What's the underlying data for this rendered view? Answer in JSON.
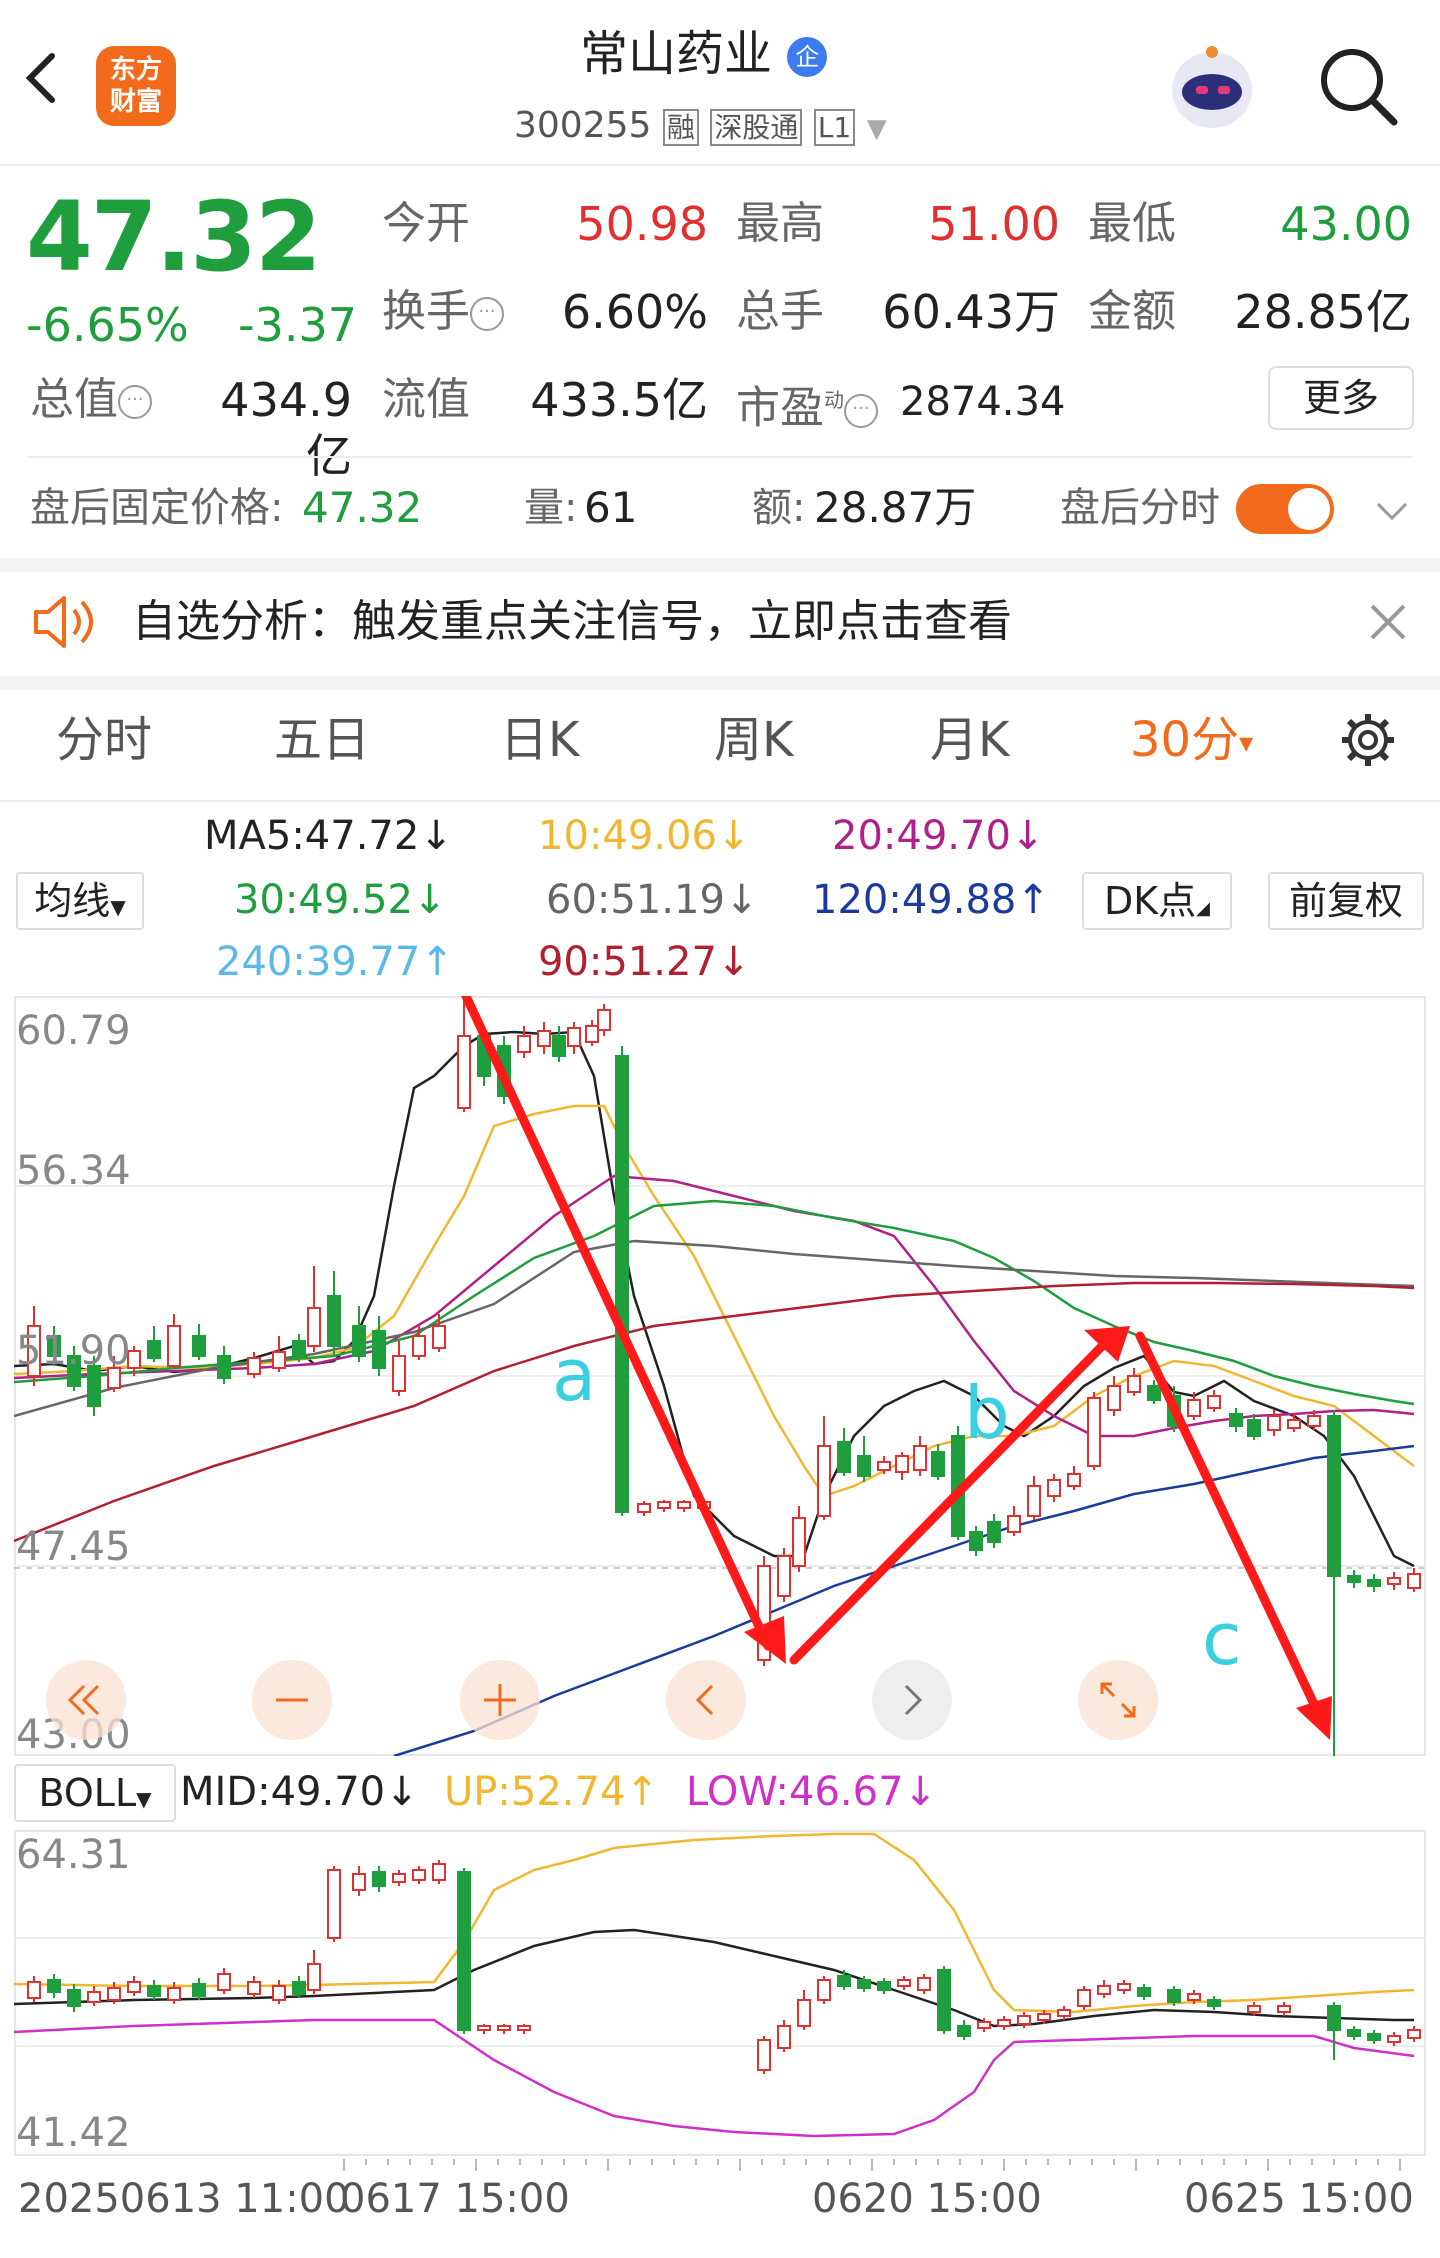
{
  "header": {
    "brand_logo_text": "东方财富",
    "stock_name": "常山药业",
    "badge": "企",
    "code": "300255",
    "tags": [
      "融",
      "深股通",
      "L1"
    ]
  },
  "quote": {
    "price": "47.32",
    "change_pct": "-6.65%",
    "change": "-3.37",
    "stats": [
      {
        "label": "今开",
        "value": "50.98",
        "color": "up"
      },
      {
        "label": "最高",
        "value": "51.00",
        "color": "up"
      },
      {
        "label": "最低",
        "value": "43.00",
        "color": "down"
      },
      {
        "label": "换手",
        "value": "6.60%",
        "color": "plain"
      },
      {
        "label": "总手",
        "value": "60.43万",
        "color": "plain"
      },
      {
        "label": "金额",
        "value": "28.85亿",
        "color": "plain"
      },
      {
        "label": "总值",
        "value": "434.9亿",
        "color": "plain"
      },
      {
        "label": "流值",
        "value": "433.5亿",
        "color": "plain"
      },
      {
        "label": "市盈",
        "sup": "动",
        "value": "2874.34",
        "color": "plain"
      }
    ],
    "more_label": "更多"
  },
  "after_hours": {
    "price_label": "盘后固定价格:",
    "price": "47.32",
    "vol_label": "量:",
    "vol": "61",
    "amt_label": "额:",
    "amt": "28.87万",
    "toggle_label": "盘后分时",
    "toggle_on": true
  },
  "notice": {
    "text": "自选分析：触发重点关注信号，立即点击查看"
  },
  "tabs": {
    "items": [
      "分时",
      "五日",
      "日K",
      "周K",
      "月K"
    ],
    "active": "30分",
    "active_arrow": "▾"
  },
  "ma_bar": {
    "selector": "均线",
    "items": [
      {
        "label": "MA5:47.72↓",
        "color": "#222222"
      },
      {
        "label": "10:49.06↓",
        "color": "#f2b731"
      },
      {
        "label": "20:49.70↓",
        "color": "#b0208a"
      },
      {
        "label": "30:49.52↓",
        "color": "#1e9e3c"
      },
      {
        "label": "60:51.19↓",
        "color": "#666666"
      },
      {
        "label": "120:49.88↑",
        "color": "#1a3a9e"
      },
      {
        "label": "240:39.77↑",
        "color": "#5bb8e8"
      },
      {
        "label": "90:51.27↓",
        "color": "#b02030"
      }
    ],
    "dk_label": "DK点",
    "fq_label": "前复权"
  },
  "main_chart": {
    "y_labels": [
      "60.79",
      "56.34",
      "51.90",
      "47.45",
      "43.00"
    ],
    "annotations": [
      "a",
      "b",
      "c"
    ]
  },
  "boll": {
    "selector": "BOLL",
    "mid": "MID:49.70↓",
    "up": "UP:52.74↑",
    "low": "LOW:46.67↓",
    "y_labels": [
      "64.31",
      "41.42"
    ]
  },
  "x_axis": {
    "labels": [
      "20250613 11:00",
      "0617 15:00",
      "0620 15:00",
      "0625 15:00"
    ]
  },
  "colors": {
    "up": "#e03030",
    "down": "#1e9e3c",
    "accent": "#f26b1d",
    "annot": "#3ad0e0",
    "arrow": "#ff1a1a"
  },
  "chart_data": {
    "type": "candlestick",
    "series": [
      {
        "name": "MA5",
        "last": "47.72"
      },
      {
        "name": "10",
        "last": "49.06"
      },
      {
        "name": "20",
        "last": "49.70"
      },
      {
        "name": "30",
        "last": "49.52"
      },
      {
        "name": "60",
        "last": "51.19"
      },
      {
        "name": "120",
        "last": "49.88"
      },
      {
        "name": "240",
        "last": "39.77"
      },
      {
        "name": "90",
        "last": "51.27"
      }
    ],
    "ylim": [
      43.0,
      60.79
    ]
  }
}
